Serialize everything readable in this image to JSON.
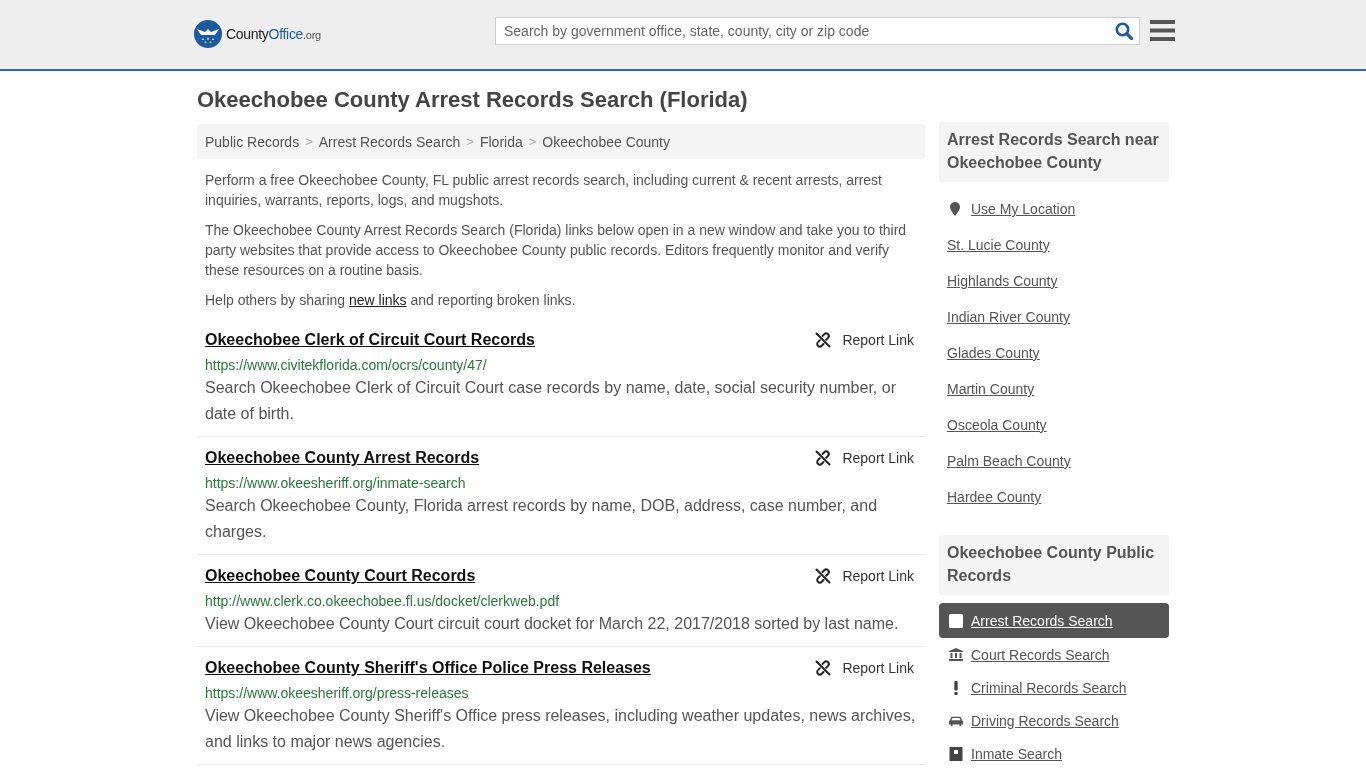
{
  "header": {
    "logo": {
      "brand": "County",
      "brand_accent": "Office",
      "domain": ".org"
    },
    "search": {
      "placeholder": "Search by government office, state, county, city or zip code"
    }
  },
  "page_title": "Okeechobee County Arrest Records Search (Florida)",
  "breadcrumb": [
    {
      "label": "Public Records",
      "separator": ">"
    },
    {
      "label": "Arrest Records Search",
      "separator": ">"
    },
    {
      "label": "Florida",
      "separator": ">"
    },
    {
      "label": "Okeechobee County"
    }
  ],
  "intro": [
    "Perform a free Okeechobee County, FL public arrest records search, including current & recent arrests, arrest inquiries, warrants, reports, logs, and mugshots.",
    "The Okeechobee County Arrest Records Search (Florida) links below open in a new window and take you to third party websites that provide access to Okeechobee County public records. Editors frequently monitor and verify these resources on a routine basis."
  ],
  "share_note": {
    "before": "Help others by sharing ",
    "link": "new links",
    "after": " and reporting broken links."
  },
  "listings": [
    {
      "title": "Okeechobee Clerk of Circuit Court Records",
      "url": "https://www.civitekflorida.com/ocrs/county/47/",
      "description": "Search Okeechobee Clerk of Circuit Court case records by name, date, social security number, or date of birth.",
      "action": "Report Link"
    },
    {
      "title": "Okeechobee County Arrest Records",
      "url": "https://www.okeesheriff.org/inmate-search",
      "description": "Search Okeechobee County, Florida arrest records by name, DOB, address, case number, and charges.",
      "action": "Report Link"
    },
    {
      "title": "Okeechobee County Court Records",
      "url": "http://www.clerk.co.okeechobee.fl.us/docket/clerkweb.pdf",
      "description": "View Okeechobee County Court circuit court docket for March 22, 2017/2018 sorted by last name.",
      "action": "Report Link"
    },
    {
      "title": "Okeechobee County Sheriff's Office Police Press Releases",
      "url": "https://www.okeesheriff.org/press-releases",
      "description": "View Okeechobee County Sheriff's Office press releases, including weather updates, news archives, and links to major news agencies.",
      "action": "Report Link"
    }
  ],
  "sidebar": {
    "nearby": {
      "title": "Arrest Records Search near Okeechobee County",
      "location_link": "Use My Location",
      "items": [
        "St. Lucie County",
        "Highlands County",
        "Indian River County",
        "Glades County",
        "Martin County",
        "Osceola County",
        "Palm Beach County",
        "Hardee County"
      ]
    },
    "public_records": {
      "title": "Okeechobee County Public Records",
      "items": [
        {
          "label": "Arrest Records Search",
          "kind": "arrest",
          "selected": true
        },
        {
          "label": "Court Records Search",
          "kind": "court",
          "selected": false
        },
        {
          "label": "Criminal Records Search",
          "kind": "criminal",
          "selected": false
        },
        {
          "label": "Driving Records Search",
          "kind": "driving",
          "selected": false
        },
        {
          "label": "Inmate Search",
          "kind": "inmate",
          "selected": false
        }
      ]
    }
  }
}
